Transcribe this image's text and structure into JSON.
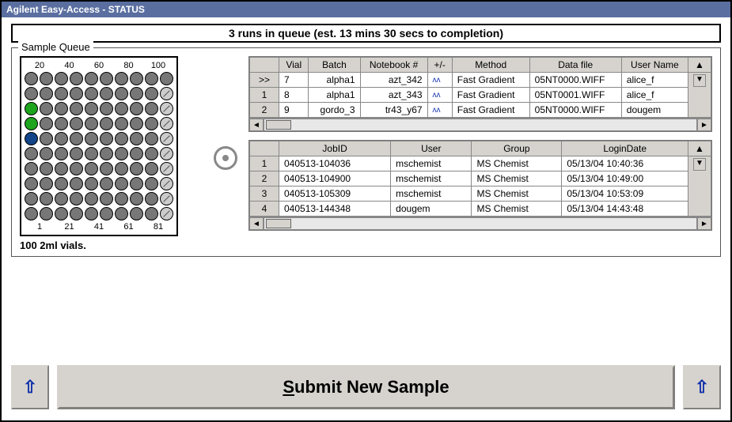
{
  "window_title": "Agilent Easy-Access - STATUS",
  "banner": "3 runs in queue (est. 13 mins 30 secs to completion)",
  "queue_legend": "Sample Queue",
  "tray": {
    "top_labels": [
      "20",
      "40",
      "60",
      "80",
      "100"
    ],
    "bottom_labels": [
      "1",
      "21",
      "41",
      "61",
      "81"
    ],
    "caption": "100 2ml vials."
  },
  "runs_table": {
    "headers": [
      "",
      "Vial",
      "Batch",
      "Notebook #",
      "+/-",
      "Method",
      "Data file",
      "User Name"
    ],
    "rows": [
      {
        "cur": ">>",
        "vial": "7",
        "batch": "alpha1",
        "nb": "azt_342",
        "pm": "",
        "method": "Fast Gradient",
        "file": "05NT0000.WIFF",
        "user": "alice_f"
      },
      {
        "cur": "1",
        "vial": "8",
        "batch": "alpha1",
        "nb": "azt_343",
        "pm": "",
        "method": "Fast Gradient",
        "file": "05NT0001.WIFF",
        "user": "alice_f"
      },
      {
        "cur": "2",
        "vial": "9",
        "batch": "gordo_3",
        "nb": "tr43_y67",
        "pm": "",
        "method": "Fast Gradient",
        "file": "05NT0000.WIFF",
        "user": "dougem"
      }
    ]
  },
  "jobs_table": {
    "headers": [
      "",
      "JobID",
      "User",
      "Group",
      "LoginDate"
    ],
    "rows": [
      {
        "n": "1",
        "job": "040513-104036",
        "user": "mschemist",
        "group": "MS Chemist",
        "login": "05/13/04 10:40:36"
      },
      {
        "n": "2",
        "job": "040513-104900",
        "user": "mschemist",
        "group": "MS Chemist",
        "login": "05/13/04 10:49:00"
      },
      {
        "n": "3",
        "job": "040513-105309",
        "user": "mschemist",
        "group": "MS Chemist",
        "login": "05/13/04 10:53:09"
      },
      {
        "n": "4",
        "job": "040513-144348",
        "user": "dougem",
        "group": "MS Chemist",
        "login": "05/13/04 14:43:48"
      }
    ]
  },
  "submit_label": "Submit New Sample"
}
